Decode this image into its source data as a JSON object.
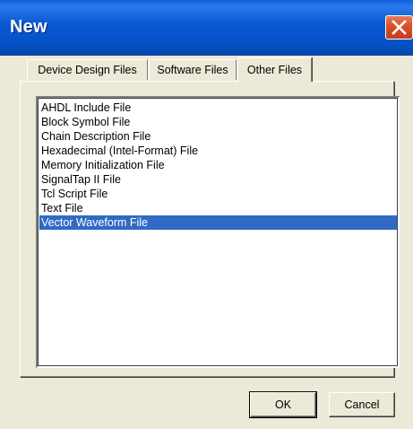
{
  "window": {
    "title": "New"
  },
  "tabs": [
    {
      "label": "Device Design Files",
      "active": false
    },
    {
      "label": "Software Files",
      "active": false
    },
    {
      "label": "Other Files",
      "active": true
    }
  ],
  "file_list": {
    "items": [
      "AHDL Include File",
      "Block Symbol File",
      "Chain Description File",
      "Hexadecimal (Intel-Format) File",
      "Memory Initialization File",
      "SignalTap II File",
      "Tcl Script File",
      "Text File",
      "Vector Waveform File"
    ],
    "selected": "Vector Waveform File"
  },
  "buttons": {
    "ok": "OK",
    "cancel": "Cancel"
  },
  "colors": {
    "titlebar": "#0553c9",
    "selection": "#316ac5",
    "dialog_face": "#ece9d8",
    "close_button": "#d8502c"
  },
  "icons": {
    "close": "close-icon"
  }
}
